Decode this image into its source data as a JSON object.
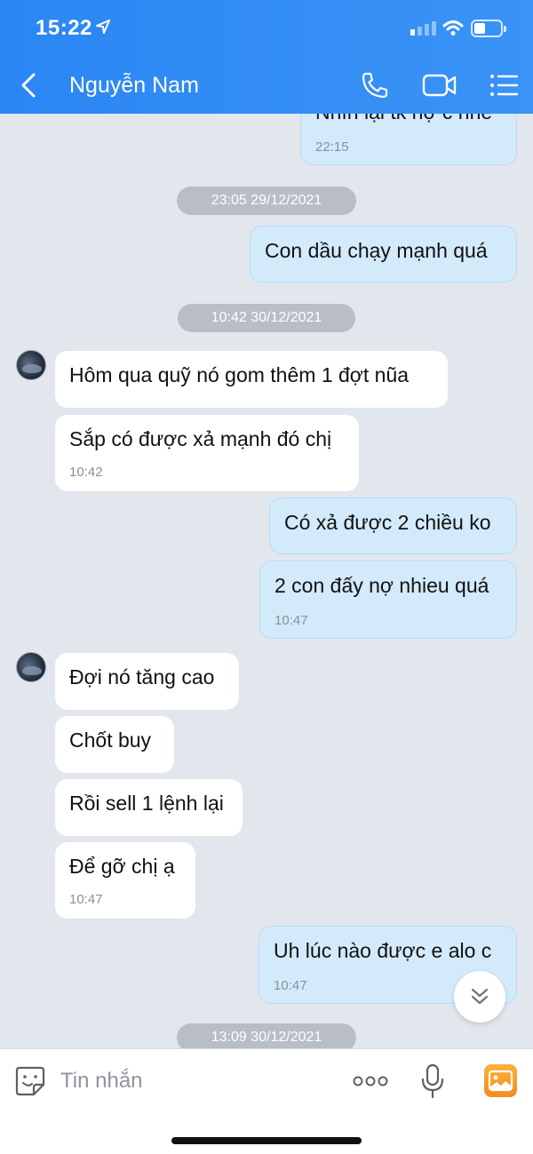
{
  "status_bar": {
    "time": "15:22"
  },
  "header": {
    "contact_name": "Nguyễn Nam"
  },
  "messages": [
    {
      "dir": "out",
      "text": "Nhìn lại tk nợ c nhé",
      "time": "22:15"
    },
    {
      "type": "date",
      "text": "23:05 29/12/2021"
    },
    {
      "dir": "out",
      "text": "Con dầu chạy mạnh quá"
    },
    {
      "type": "date",
      "text": "10:42 30/12/2021"
    },
    {
      "dir": "in",
      "text": "Hôm qua quỹ nó gom thêm 1 đợt nũa"
    },
    {
      "dir": "in",
      "text": "Sắp có được xả mạnh đó chị",
      "time": "10:42"
    },
    {
      "dir": "out",
      "text": "Có xả được 2 chiều ko"
    },
    {
      "dir": "out",
      "text": "2 con đấy nợ nhieu quá",
      "time": "10:47"
    },
    {
      "dir": "in",
      "text": "Đợi nó tăng cao"
    },
    {
      "dir": "in",
      "text": "Chốt buy"
    },
    {
      "dir": "in",
      "text": "Rồi sell 1 lệnh lại"
    },
    {
      "dir": "in",
      "text": "Để gỡ chị ạ",
      "time": "10:47"
    },
    {
      "dir": "out",
      "text": "Uh lúc nào được e alo c",
      "time": "10:47"
    },
    {
      "type": "date",
      "text": "13:09 30/12/2021"
    }
  ],
  "input": {
    "placeholder": "Tin nhắn"
  },
  "colors": {
    "header": "#2a86f3",
    "outgoing_bubble": "#d3eafb",
    "incoming_bubble": "#ffffff",
    "chat_bg": "#e2e7ee"
  }
}
